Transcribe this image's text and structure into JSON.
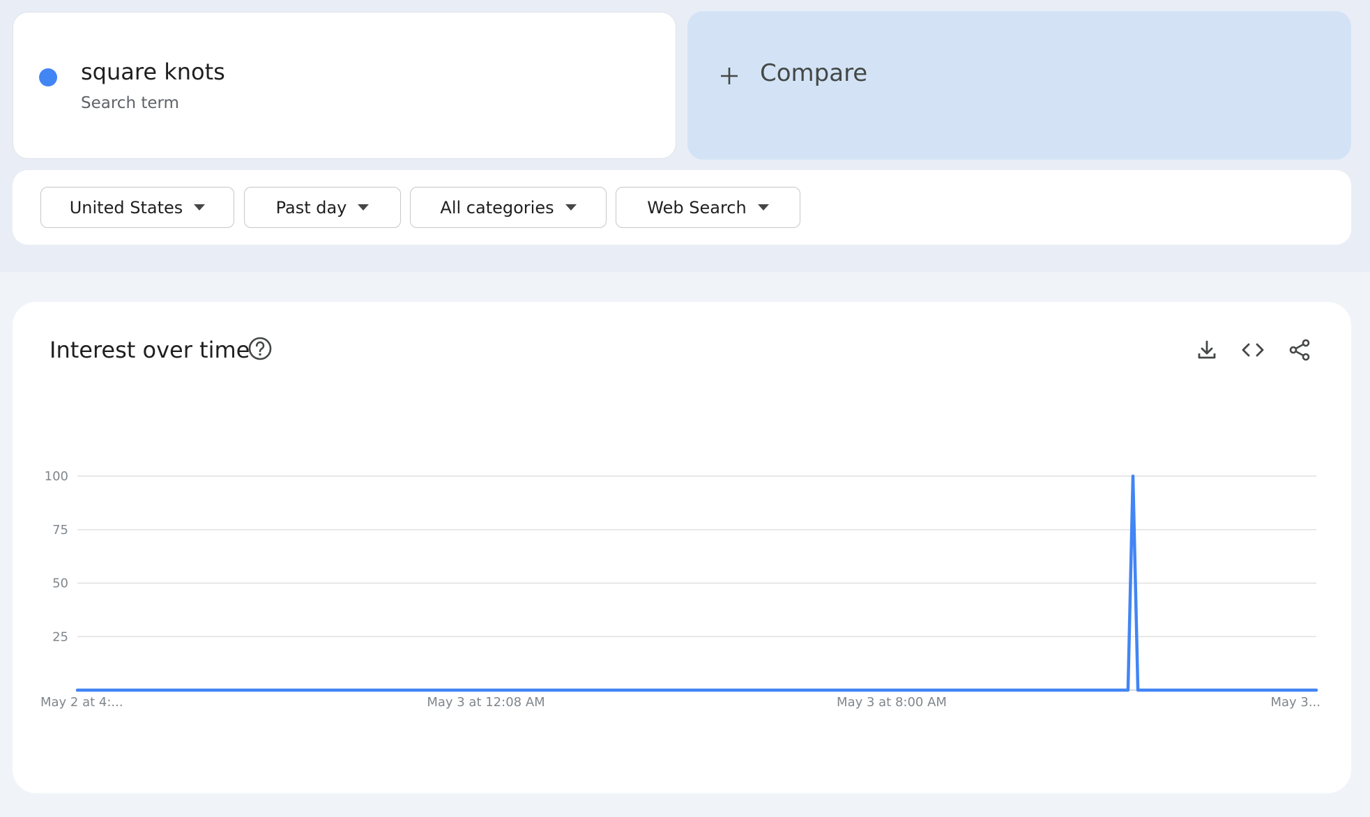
{
  "term": {
    "name": "square knots",
    "type": "Search term",
    "color": "#4285f4"
  },
  "compare": {
    "label": "Compare"
  },
  "filters": [
    {
      "label": "United States"
    },
    {
      "label": "Past day"
    },
    {
      "label": "All categories"
    },
    {
      "label": "Web Search"
    }
  ],
  "panel": {
    "title": "Interest over time",
    "icons": [
      "help-icon",
      "download-icon",
      "embed-code-icon",
      "share-icon"
    ]
  },
  "chart_data": {
    "type": "line",
    "ylim": [
      0,
      100
    ],
    "y_ticks": [
      25,
      50,
      75,
      100
    ],
    "x_tick_labels": [
      "May 2 at 4:...",
      "May 3 at 12:08 AM",
      "May 3 at 8:00 AM",
      "May 3..."
    ],
    "grid": true,
    "series": [
      {
        "color": "#4285f4",
        "values": [
          0,
          0,
          0,
          0,
          0,
          0,
          0,
          0,
          0,
          0,
          0,
          0,
          0,
          0,
          0,
          0,
          0,
          0,
          0,
          0,
          0,
          0,
          0,
          0,
          0,
          0,
          0,
          0,
          0,
          0,
          0,
          0,
          0,
          0,
          0,
          0,
          0,
          0,
          0,
          0,
          0,
          0,
          0,
          0,
          0,
          0,
          0,
          0,
          0,
          0,
          0,
          0,
          0,
          0,
          0,
          0,
          0,
          0,
          0,
          0,
          0,
          0,
          0,
          0,
          0,
          0,
          0,
          0,
          0,
          0,
          0,
          0,
          0,
          0,
          0,
          0,
          0,
          0,
          0,
          0,
          0,
          0,
          0,
          0,
          0,
          0,
          0,
          0,
          0,
          0,
          0,
          0,
          0,
          0,
          0,
          0,
          0,
          0,
          0,
          0,
          0,
          0,
          0,
          0,
          0,
          0,
          0,
          0,
          0,
          0,
          0,
          0,
          0,
          0,
          0,
          0,
          0,
          0,
          0,
          0,
          0,
          0,
          0,
          0,
          0,
          0,
          0,
          0,
          0,
          0,
          0,
          0,
          0,
          0,
          0,
          0,
          0,
          0,
          0,
          0,
          0,
          0,
          0,
          0,
          0,
          0,
          0,
          0,
          0,
          0,
          0,
          0,
          0,
          0,
          0,
          0,
          0,
          0,
          0,
          0,
          0,
          0,
          0,
          0,
          0,
          0,
          0,
          0,
          0,
          0,
          0,
          0,
          0,
          0,
          0,
          0,
          0,
          0,
          0,
          0,
          0,
          0,
          0,
          0,
          0,
          0,
          0,
          0,
          0,
          0,
          0,
          0,
          0,
          0,
          0,
          0,
          0,
          0,
          0,
          0,
          0,
          0,
          0,
          0,
          0,
          0,
          0,
          0,
          0,
          0,
          0,
          0,
          0,
          100,
          0,
          0,
          0,
          0,
          0,
          0,
          0,
          0,
          0,
          0,
          0,
          0,
          0,
          0,
          0,
          0,
          0,
          0,
          0,
          0,
          0,
          0,
          0,
          0,
          0,
          0,
          0,
          0,
          0,
          0,
          0,
          0,
          0,
          0,
          0,
          0,
          0
        ]
      }
    ]
  }
}
